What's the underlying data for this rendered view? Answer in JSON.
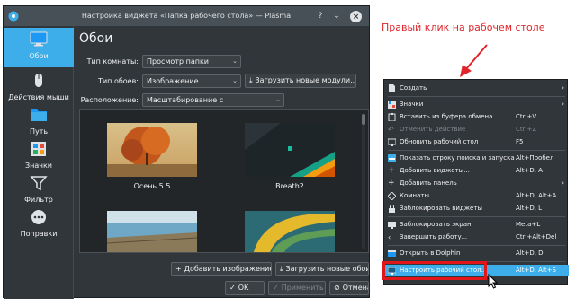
{
  "dialog": {
    "title": "Настройка виджета «Папка рабочего стола» — Plasma",
    "sidebar": [
      {
        "label": "Обои",
        "icon": "monitor-icon"
      },
      {
        "label": "Действия мыши",
        "icon": "mouse-icon"
      },
      {
        "label": "Путь",
        "icon": "folder-icon"
      },
      {
        "label": "Значки",
        "icon": "icons-grid-icon"
      },
      {
        "label": "Фильтр",
        "icon": "filter-icon"
      },
      {
        "label": "Поправки",
        "icon": "more-icon"
      }
    ],
    "page_title": "Обои",
    "layout_label": "Тип комнаты:",
    "layout_value": "Просмотр папки",
    "wallpaper_type_label": "Тип обоев:",
    "wallpaper_type_value": "Изображение",
    "get_new_plugins": "Загрузить новые модули...",
    "positioning_label": "Расположение:",
    "positioning_value": "Масштабирование с кадрированием",
    "wallpapers": [
      {
        "label": "Осень 5.5"
      },
      {
        "label": "Breath2"
      },
      {
        "label": ""
      },
      {
        "label": ""
      }
    ],
    "add_image": "Добавить изображение...",
    "get_new_wallpapers": "Загрузить новые обои...",
    "ok": "OK",
    "apply": "Применить",
    "cancel": "Отмена"
  },
  "annotation": "Правый клик на рабочем столе",
  "menu": {
    "items": [
      {
        "label": "Создать",
        "shortcut": "",
        "submenu": true,
        "disabled": false
      },
      {
        "label": "Значки",
        "shortcut": "",
        "submenu": true,
        "disabled": false
      },
      {
        "label": "Вставить из буфера обмена...",
        "shortcut": "Ctrl+V",
        "submenu": false,
        "disabled": false
      },
      {
        "label": "Отменить действие",
        "shortcut": "Ctrl+Z",
        "submenu": false,
        "disabled": true
      },
      {
        "label": "Обновить рабочий стол",
        "shortcut": "F5",
        "submenu": false,
        "disabled": false
      },
      {
        "label": "Показать строку поиска и запуска",
        "shortcut": "Alt+Пробел",
        "submenu": false,
        "disabled": false
      },
      {
        "label": "Добавить виджеты...",
        "shortcut": "Alt+D, A",
        "submenu": false,
        "disabled": false
      },
      {
        "label": "Добавить панель",
        "shortcut": "",
        "submenu": true,
        "disabled": false
      },
      {
        "label": "Комнаты...",
        "shortcut": "Alt+D, Alt+A",
        "submenu": false,
        "disabled": false
      },
      {
        "label": "Заблокировать виджеты",
        "shortcut": "Alt+D, L",
        "submenu": false,
        "disabled": false
      },
      {
        "label": "Заблокировать экран",
        "shortcut": "Meta+L",
        "submenu": false,
        "disabled": false
      },
      {
        "label": "Завершить работу...",
        "shortcut": "Ctrl+Alt+Del",
        "submenu": false,
        "disabled": false
      },
      {
        "label": "Открыть в Dolphin",
        "shortcut": "Alt+D, D",
        "submenu": false,
        "disabled": false
      },
      {
        "label": "Настроить рабочий стол...",
        "shortcut": "Alt+D, Alt+S",
        "submenu": false,
        "disabled": false
      }
    ]
  },
  "colors": {
    "accent": "#3daee9",
    "window_bg": "#31363b",
    "annotation_red": "#e1252a"
  }
}
